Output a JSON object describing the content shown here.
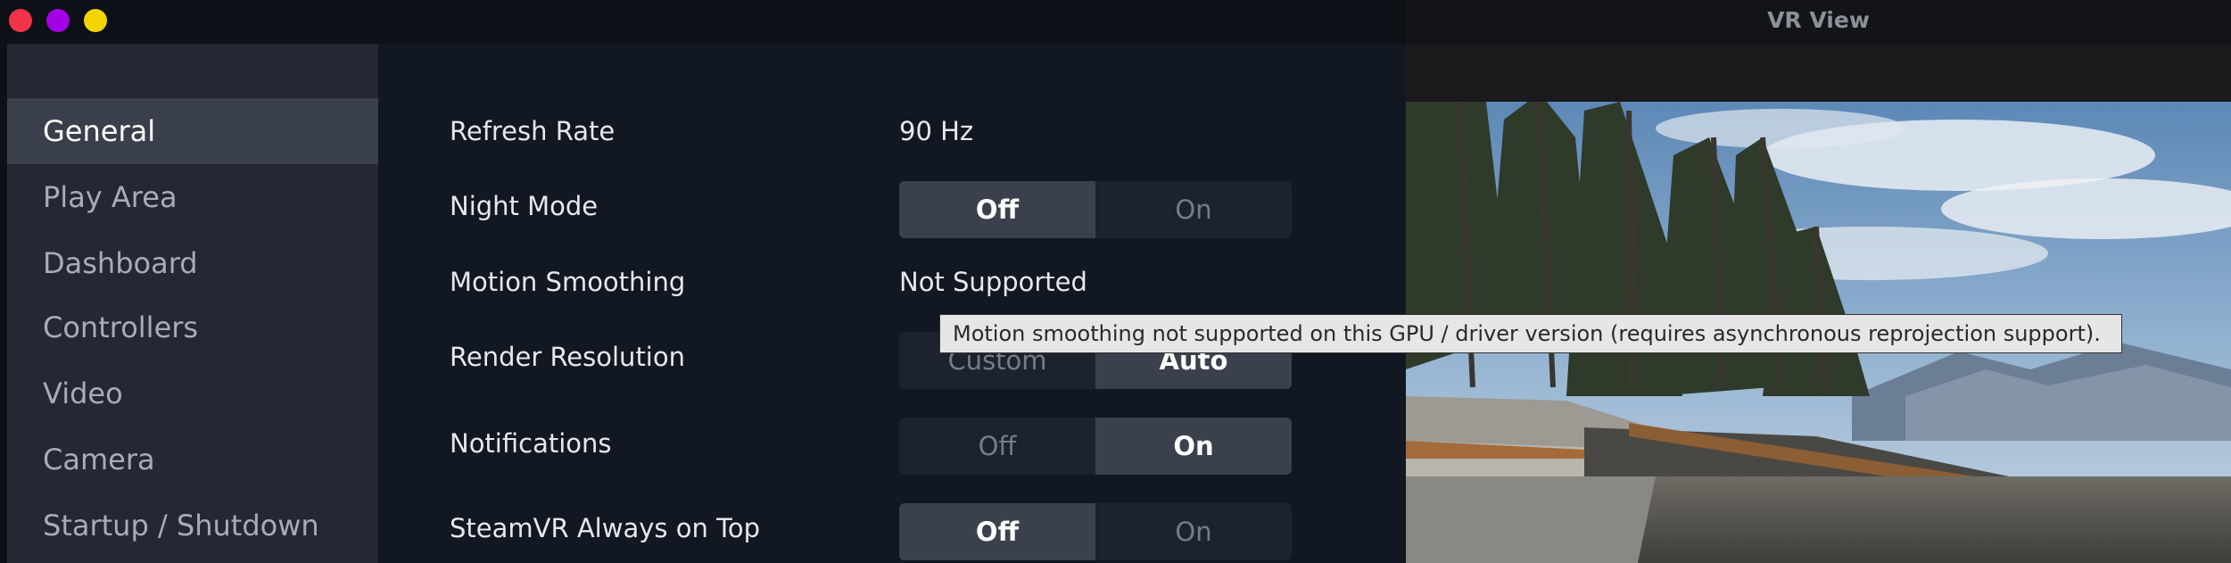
{
  "window": {
    "title": "VR View"
  },
  "sidebar": {
    "items": [
      {
        "label": "General",
        "active": true
      },
      {
        "label": "Play Area",
        "active": false
      },
      {
        "label": "Dashboard",
        "active": false
      },
      {
        "label": "Controllers",
        "active": false
      },
      {
        "label": "Video",
        "active": false
      },
      {
        "label": "Camera",
        "active": false
      },
      {
        "label": "Startup / Shutdown",
        "active": false
      }
    ]
  },
  "settings": {
    "refresh_rate": {
      "label": "Refresh Rate",
      "value": "90 Hz"
    },
    "night_mode": {
      "label": "Night Mode",
      "options": [
        "Off",
        "On"
      ],
      "selected": "Off"
    },
    "motion_smoothing": {
      "label": "Motion Smoothing",
      "value": "Not Supported"
    },
    "render_resolution": {
      "label": "Render Resolution",
      "options": [
        "Custom",
        "Auto"
      ],
      "selected": "Auto"
    },
    "notifications": {
      "label": "Notifications",
      "options": [
        "Off",
        "On"
      ],
      "selected": "On"
    },
    "always_on_top": {
      "label": "SteamVR Always on Top",
      "options": [
        "Off",
        "On"
      ],
      "selected": "Off"
    }
  },
  "tooltip": {
    "text": "Motion smoothing not supported on this GPU / driver version (requires asynchronous reprojection support)."
  },
  "colors": {
    "close": "#f0354a",
    "minimize": "#a400e6",
    "maximize": "#f2d400",
    "sidebar_bg": "#232833",
    "sidebar_active": "#3a404b",
    "panel_bg": "#111821",
    "toggle_selected": "#3a414c"
  }
}
